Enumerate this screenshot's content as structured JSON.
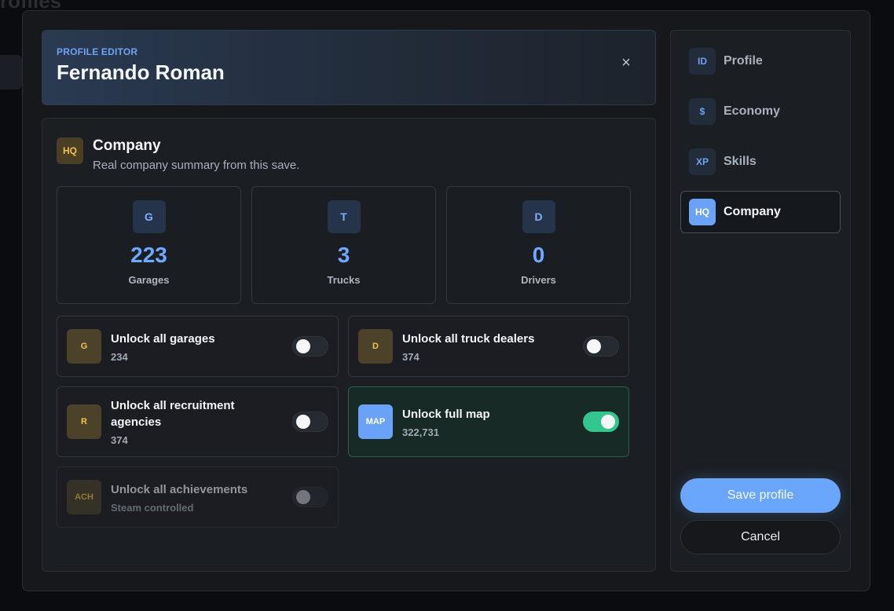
{
  "background": {
    "title": "rofiles"
  },
  "header": {
    "eyebrow": "PROFILE EDITOR",
    "title": "Fernando Roman",
    "close_glyph": "×"
  },
  "section": {
    "badge": "HQ",
    "title": "Company",
    "subtitle": "Real company summary from this save."
  },
  "stats": [
    {
      "badge": "G",
      "value": "223",
      "label": "Garages"
    },
    {
      "badge": "T",
      "value": "3",
      "label": "Trucks"
    },
    {
      "badge": "D",
      "value": "0",
      "label": "Drivers"
    }
  ],
  "toggles": [
    {
      "badge": "G",
      "title": "Unlock all garages",
      "sub": "234",
      "on": false,
      "disabled": false
    },
    {
      "badge": "D",
      "title": "Unlock all truck dealers",
      "sub": "374",
      "on": false,
      "disabled": false
    },
    {
      "badge": "R",
      "title": "Unlock all recruitment agencies",
      "sub": "374",
      "on": false,
      "disabled": false
    },
    {
      "badge": "MAP",
      "title": "Unlock full map",
      "sub": "322,731",
      "on": true,
      "disabled": false
    },
    {
      "badge": "ACH",
      "title": "Unlock all achievements",
      "sub": "Steam controlled",
      "on": false,
      "disabled": true
    }
  ],
  "nav": [
    {
      "badge": "ID",
      "label": "Profile",
      "active": false
    },
    {
      "badge": "$",
      "label": "Economy",
      "active": false
    },
    {
      "badge": "XP",
      "label": "Skills",
      "active": false
    },
    {
      "badge": "HQ",
      "label": "Company",
      "active": true
    }
  ],
  "actions": {
    "save_label": "Save profile",
    "cancel_label": "Cancel"
  },
  "colors": {
    "accent": "#6aa6fc",
    "success": "#34c68f",
    "gold": "#f2c44e"
  }
}
